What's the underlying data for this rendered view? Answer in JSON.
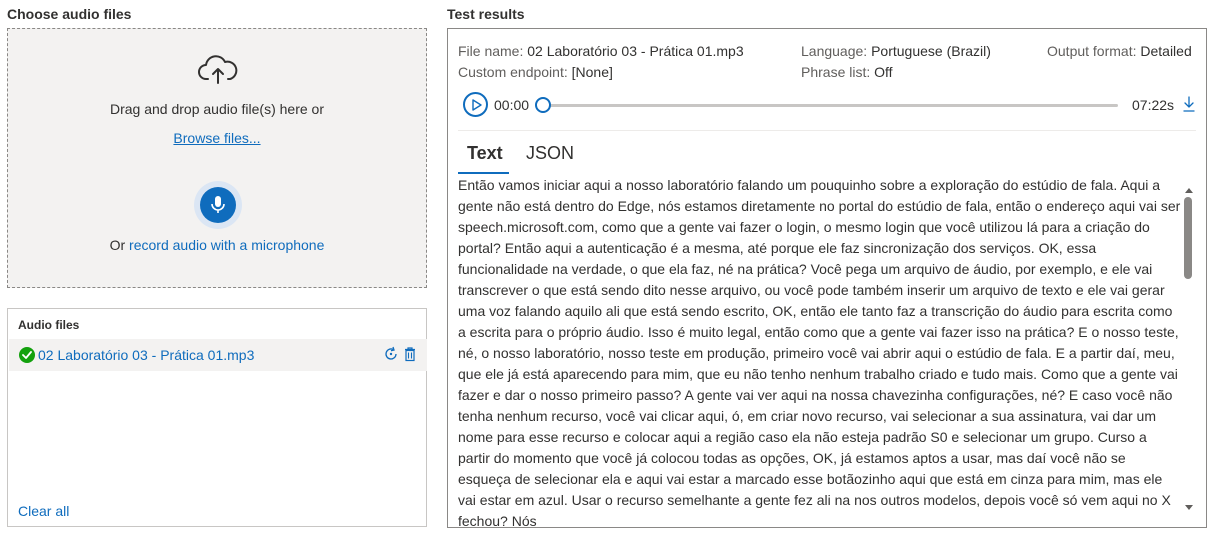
{
  "left": {
    "choose_title": "Choose audio files",
    "drop_text": "Drag and drop audio file(s) here or",
    "browse_link": "Browse files...",
    "record_prefix": "Or ",
    "record_link": "record audio with a microphone",
    "upload_icon": "cloud-upload-icon",
    "mic_icon": "microphone-icon"
  },
  "audio_files": {
    "title": "Audio files",
    "items": [
      {
        "name": "02 Laboratório 03 - Prática 01.mp3",
        "status_icon": "check-circle-icon",
        "status_color": "#13a10e",
        "actions": [
          "retry-icon",
          "delete-icon"
        ]
      }
    ],
    "clear_all": "Clear all"
  },
  "results": {
    "title": "Test results",
    "file_name_label": "File name:",
    "file_name": "02 Laboratório 03 - Prática 01.mp3",
    "language_label": "Language:",
    "language": "Portuguese (Brazil)",
    "output_format_label": "Output format:",
    "output_format": "Detailed",
    "custom_endpoint_label": "Custom endpoint:",
    "custom_endpoint": "[None]",
    "phrase_list_label": "Phrase list:",
    "phrase_list": "Off",
    "player": {
      "current_time": "00:00",
      "duration": "07:22s",
      "progress_fraction": 0,
      "play_icon": "play-icon",
      "download_icon": "download-icon"
    },
    "tabs": [
      {
        "label": "Text",
        "active": true
      },
      {
        "label": "JSON",
        "active": false
      }
    ],
    "transcript": "Então vamos iniciar aqui a nosso laboratório falando um pouquinho sobre a exploração do estúdio de fala. Aqui a gente não está dentro do Edge, nós estamos diretamente no portal do estúdio de fala, então o endereço aqui vai ser speech.microsoft.com, como que a gente vai fazer o login, o mesmo login que você utilizou lá para a criação do portal? Então aqui a autenticação é a mesma, até porque ele faz sincronização dos serviços. OK, essa funcionalidade na verdade, o que ela faz, né na prática? Você pega um arquivo de áudio, por exemplo, e ele vai transcrever o que está sendo dito nesse arquivo, ou você pode também inserir um arquivo de texto e ele vai gerar uma voz falando aquilo ali que está sendo escrito, OK, então ele tanto faz a transcrição do áudio para escrita como a escrita para o próprio áudio. Isso é muito legal, então como que a gente vai fazer isso na prática? E o nosso teste, né, o nosso laboratório, nosso teste em produção, primeiro você vai abrir aqui o estúdio de fala. E a partir daí, meu, que ele já está aparecendo para mim, que eu não tenho nenhum trabalho criado e tudo mais. Como que a gente vai fazer e dar o nosso primeiro passo? A gente vai ver aqui na nossa chavezinha configurações, né? E caso você não tenha nenhum recurso, você vai clicar aqui, ó, em criar novo recurso, vai selecionar a sua assinatura, vai dar um nome para esse recurso e colocar aqui a região caso ela não esteja padrão S0 e selecionar um grupo. Curso a partir do momento que você já colocou todas as opções, OK, já estamos aptos a usar, mas daí você não se esqueça de selecionar ela e aqui vai estar a marcado esse botãozinho aqui que está em cinza para mim, mas ele vai estar em azul. Usar o recurso semelhante a gente fez ali na nos outros modelos, depois você só vem aqui no X fechou? Nós"
  },
  "colors": {
    "accent": "#0f6cbd",
    "success": "#13a10e",
    "dropzone_bg": "#f3f2f1"
  }
}
